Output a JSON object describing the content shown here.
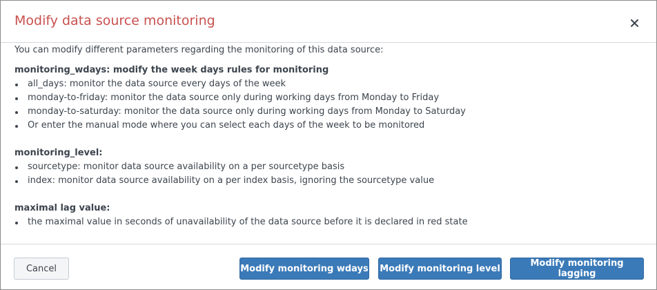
{
  "dialog": {
    "title": "Modify data source monitoring",
    "intro": "You can modify different parameters regarding the monitoring of this data source:",
    "sections": [
      {
        "title": "monitoring_wdays: modify the week days rules for monitoring",
        "items": [
          "all_days: monitor the data source every days of the week",
          "monday-to-friday: monitor the data source only during working days from Monday to Friday",
          "monday-to-saturday: monitor the data source only during working days from Monday to Saturday",
          "Or enter the manual mode where you can select each days of the week to be monitored"
        ]
      },
      {
        "title": "monitoring_level:",
        "items": [
          "sourcetype: monitor data source availability on a per sourcetype basis",
          "index: monitor data source availability on a per index basis, ignoring the sourcetype value"
        ]
      },
      {
        "title": "maximal lag value:",
        "items": [
          "the maximal value in seconds of unavailability of the data source before it is declared in red state"
        ]
      }
    ]
  },
  "footer": {
    "cancel_label": "Cancel",
    "wdays_label": "Modify monitoring wdays",
    "level_label": "Modify monitoring level",
    "lagging_label": "Modify monitoring lagging"
  },
  "icons": {
    "close": "close-icon"
  },
  "colors": {
    "title": "#c8504e",
    "primary_button": "#3b7ab8",
    "text": "#3c444d"
  }
}
